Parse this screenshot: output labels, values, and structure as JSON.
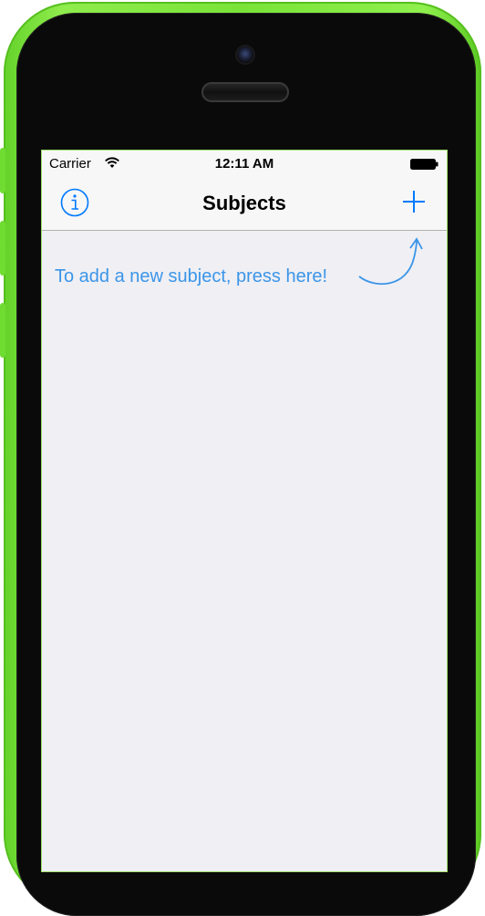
{
  "status_bar": {
    "carrier": "Carrier",
    "time": "12:11 AM"
  },
  "nav_bar": {
    "title": "Subjects",
    "info_icon": "info-circle-icon",
    "add_icon": "plus-icon"
  },
  "content": {
    "hint_text": "To add a new subject, press here!"
  },
  "colors": {
    "accent": "#007aff",
    "hint": "#3b95e8",
    "background": "#efeff4",
    "device_body": "#79e338"
  }
}
